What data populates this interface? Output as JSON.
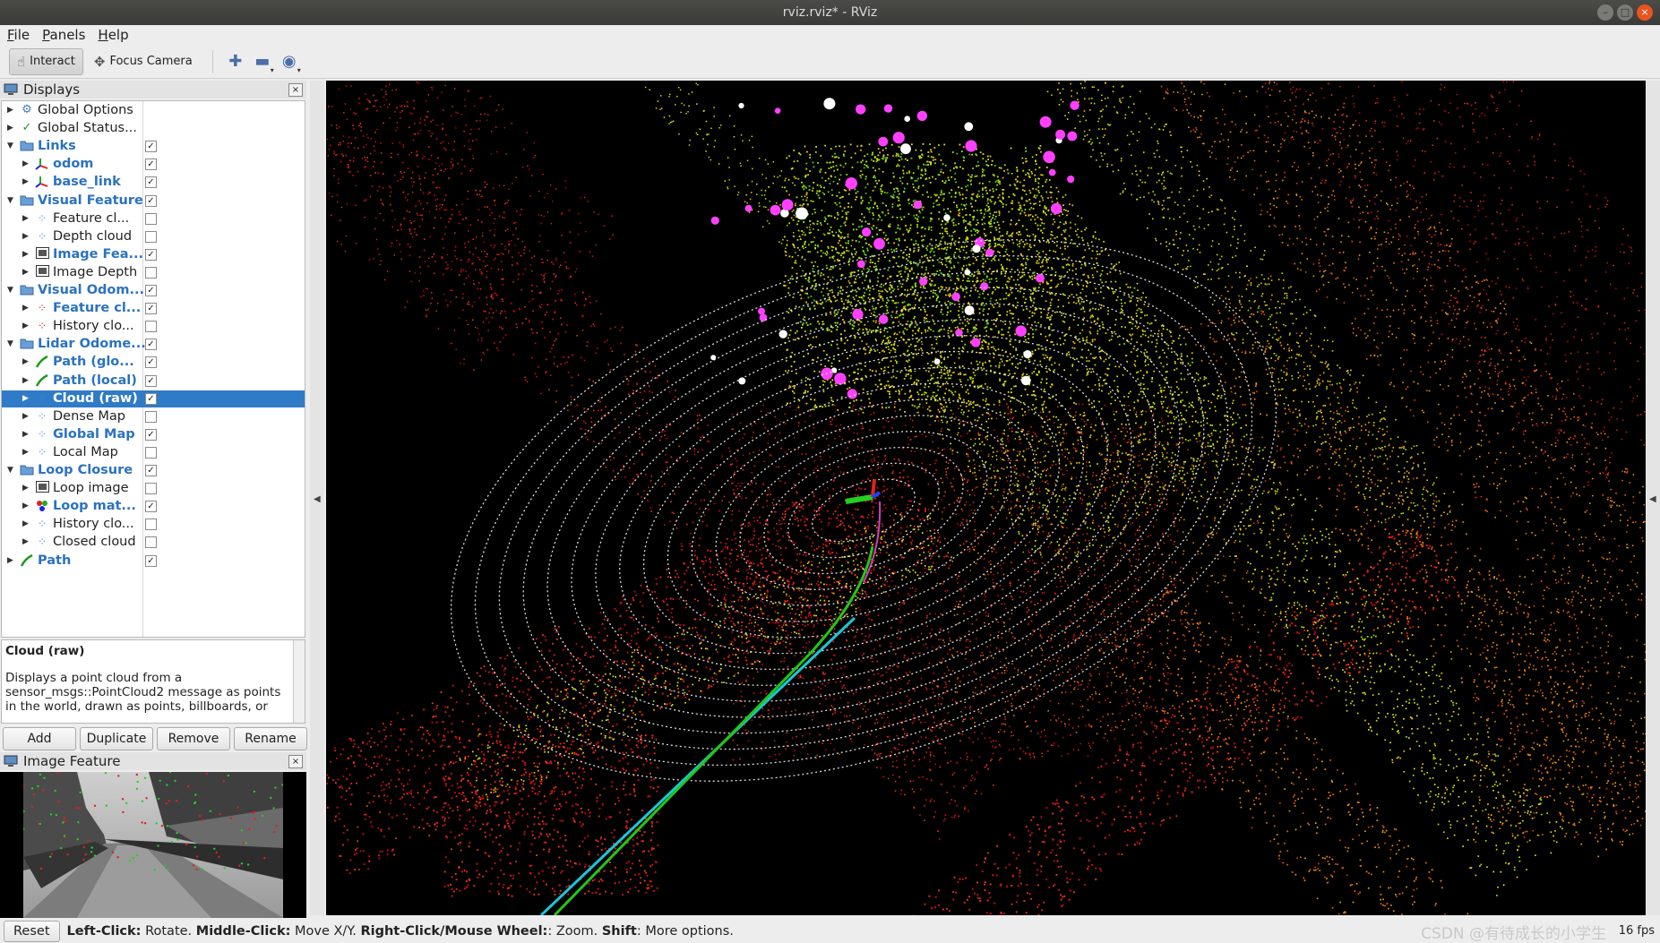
{
  "window": {
    "title": "rviz.rviz* - RViz"
  },
  "menu": [
    "File",
    "Panels",
    "Help"
  ],
  "toolbar": {
    "interact": "Interact",
    "focus_camera": "Focus Camera"
  },
  "displays_panel": {
    "title": "Displays",
    "items": [
      {
        "label": "Global Options",
        "icon": "gear-icon",
        "indent": 0,
        "expand": "collapsed",
        "bold": false,
        "checkbox": null
      },
      {
        "label": "Global Status...",
        "icon": "check-icon",
        "indent": 0,
        "expand": "collapsed",
        "bold": false,
        "checkbox": null
      },
      {
        "label": "Links",
        "icon": "folder-icon",
        "indent": 0,
        "expand": "expanded",
        "bold": true,
        "checkbox": true
      },
      {
        "label": "odom",
        "icon": "axes-icon",
        "indent": 1,
        "expand": "collapsed",
        "bold": true,
        "checkbox": true
      },
      {
        "label": "base_link",
        "icon": "axes-icon",
        "indent": 1,
        "expand": "collapsed",
        "bold": true,
        "checkbox": true
      },
      {
        "label": "Visual Feature",
        "icon": "folder-icon",
        "indent": 0,
        "expand": "expanded",
        "bold": true,
        "checkbox": true
      },
      {
        "label": "Feature cl...",
        "icon": "pointcloud-icon",
        "indent": 1,
        "expand": "collapsed",
        "bold": false,
        "checkbox": false
      },
      {
        "label": "Depth cloud",
        "icon": "pointcloud-icon",
        "indent": 1,
        "expand": "collapsed",
        "bold": false,
        "checkbox": false
      },
      {
        "label": "Image Fea...",
        "icon": "image-icon",
        "indent": 1,
        "expand": "collapsed",
        "bold": true,
        "checkbox": true
      },
      {
        "label": "Image Depth",
        "icon": "image-icon",
        "indent": 1,
        "expand": "collapsed",
        "bold": false,
        "checkbox": false
      },
      {
        "label": "Visual Odom...",
        "icon": "folder-icon",
        "indent": 0,
        "expand": "expanded",
        "bold": true,
        "checkbox": true
      },
      {
        "label": "Feature cl...",
        "icon": "red-pointcloud-icon",
        "indent": 1,
        "expand": "collapsed",
        "bold": true,
        "checkbox": true
      },
      {
        "label": "History clo...",
        "icon": "red-pointcloud-icon",
        "indent": 1,
        "expand": "collapsed",
        "bold": false,
        "checkbox": false
      },
      {
        "label": "Lidar Odome...",
        "icon": "folder-icon",
        "indent": 0,
        "expand": "expanded",
        "bold": true,
        "checkbox": true
      },
      {
        "label": "Path (glo...",
        "icon": "path-icon",
        "indent": 1,
        "expand": "collapsed",
        "bold": true,
        "checkbox": true
      },
      {
        "label": "Path (local)",
        "icon": "path-icon",
        "indent": 1,
        "expand": "collapsed",
        "bold": true,
        "checkbox": true
      },
      {
        "label": "Cloud (raw)",
        "icon": "pointcloud-icon",
        "indent": 1,
        "expand": "collapsed",
        "bold": true,
        "checkbox": true,
        "selected": true
      },
      {
        "label": "Dense Map",
        "icon": "pointcloud-icon",
        "indent": 1,
        "expand": "collapsed",
        "bold": false,
        "checkbox": false
      },
      {
        "label": "Global Map",
        "icon": "pointcloud-icon",
        "indent": 1,
        "expand": "collapsed",
        "bold": true,
        "checkbox": true
      },
      {
        "label": "Local Map",
        "icon": "pointcloud-icon",
        "indent": 1,
        "expand": "collapsed",
        "bold": false,
        "checkbox": false
      },
      {
        "label": "Loop Closure",
        "icon": "folder-icon",
        "indent": 0,
        "expand": "expanded",
        "bold": true,
        "checkbox": true
      },
      {
        "label": "Loop image",
        "icon": "image-icon",
        "indent": 1,
        "expand": "collapsed",
        "bold": false,
        "checkbox": false
      },
      {
        "label": "Loop mat...",
        "icon": "marker-icon",
        "indent": 1,
        "expand": "collapsed",
        "bold": true,
        "checkbox": true
      },
      {
        "label": "History clo...",
        "icon": "pointcloud-icon",
        "indent": 1,
        "expand": "collapsed",
        "bold": false,
        "checkbox": false
      },
      {
        "label": "Closed cloud",
        "icon": "pointcloud-icon",
        "indent": 1,
        "expand": "collapsed",
        "bold": false,
        "checkbox": false
      },
      {
        "label": "Path",
        "icon": "path-icon",
        "indent": 0,
        "expand": "collapsed",
        "bold": true,
        "checkbox": true
      }
    ]
  },
  "description": {
    "title": "Cloud (raw)",
    "text1": "Displays a point cloud from a",
    "text2": "sensor_msgs::PointCloud2 message as points",
    "text3": "in the world, drawn as points, billboards, or"
  },
  "panel_buttons": {
    "add": "Add",
    "duplicate": "Duplicate",
    "remove": "Remove",
    "rename": "Rename"
  },
  "image_panel": {
    "title": "Image Feature"
  },
  "statusbar": {
    "reset": "Reset",
    "k1": "Left-Click:",
    "v1": " Rotate. ",
    "k2": "Middle-Click:",
    "v2": " Move X/Y. ",
    "k3": "Right-Click/Mouse Wheel:",
    "v3": ": Zoom. ",
    "k4": "Shift",
    "v4": ": More options.",
    "fps": "16 fps",
    "watermark": "CSDN @有待成长的小学生"
  },
  "colors": {
    "selection": "#2f7bc7",
    "bold_item": "#2a72c0",
    "path_global": "#19c8d8",
    "path_local": "#22c814",
    "render_bg": "#000000"
  }
}
